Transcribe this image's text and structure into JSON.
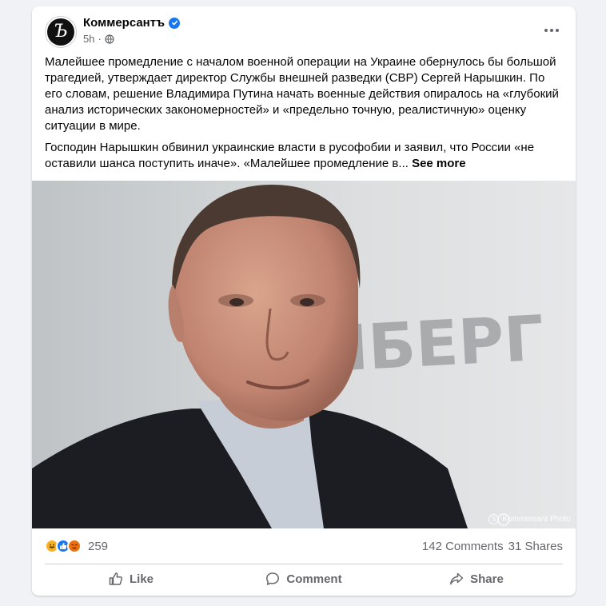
{
  "post": {
    "author": "Коммерсантъ",
    "avatar_letter": "Ъ",
    "time": "5h",
    "dot": "·",
    "paragraph1": "Малейшее промедление с началом военной операции на Украине обернулось бы большой трагедией, утверждает директор Службы внешней разведки (СВР) Сергей Нарышкин. По его словам, решение Владимира Путина начать военные действия опиралось на «глубокий анализ исторических закономерностей» и «предельно точную, реалистичную» оценку ситуации в мире.",
    "paragraph2": "Господин Нарышкин обвинил украинские власти в русофобии и заявил, что России «не оставили шанса поступить иначе». «Малейшее промедление в...",
    "see_more": "See more",
    "photo_background_text": "ЮРНБЕРГ",
    "photo_credit": "Kommersant Photo",
    "credit_letter": "Ъ"
  },
  "stats": {
    "reaction_icons": [
      "haha-icon",
      "like-icon",
      "angry-icon"
    ],
    "reaction_count": "259",
    "comments": "142 Comments",
    "shares": "31 Shares"
  },
  "actions": {
    "like": "Like",
    "comment": "Comment",
    "share": "Share"
  },
  "colors": {
    "accent": "#1877f2",
    "secondary_text": "#65676b",
    "background": "#f0f2f5"
  }
}
